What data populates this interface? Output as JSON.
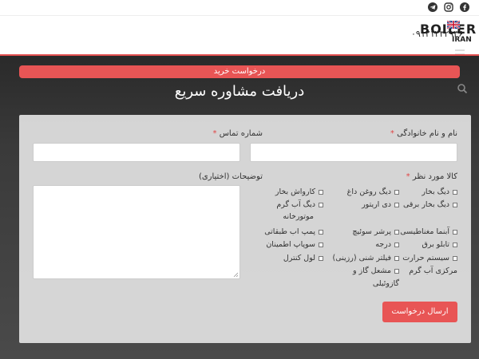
{
  "topbar": {
    "icons": [
      "facebook-icon",
      "instagram-icon",
      "telegram-icon"
    ]
  },
  "header": {
    "logo_text": "BOILER",
    "logo_subtext": "IRAN",
    "phone": "۰۹۱۲۱۲۳۲۹۳۶"
  },
  "banner": {
    "purchase_label": "درخواست خرید"
  },
  "form": {
    "title": "دریافت مشاوره سریع",
    "name_label": "نام و نام خانوادگی",
    "phone_label": "شماره تماس",
    "product_label": "کالا مورد نظر",
    "notes_label": "توضیحات (اختیاری)",
    "required_mark": "*",
    "products": [
      "دیگ بخار",
      "دیگ روغن داغ",
      "کارواش بخار",
      "دیگ بخار برقی",
      "دی اریتور",
      "دیگ آب گرم",
      "موتورخانه",
      "آبنما مغناطیسی",
      "پرشر سوئیچ",
      "پمپ اب طبقاتی",
      "تابلو برق",
      "درجه",
      "سوپاپ اطمینان",
      "سیستم حرارت",
      "فیلتر شنی (رزینی)",
      "لول کنترل",
      "مرکزی آب گرم",
      "مشعل گاز و",
      "گازوئیلی"
    ],
    "submit_label": "ارسال درخواست"
  },
  "colors": {
    "accent": "#e85555",
    "panel": "#e1e1e1"
  }
}
